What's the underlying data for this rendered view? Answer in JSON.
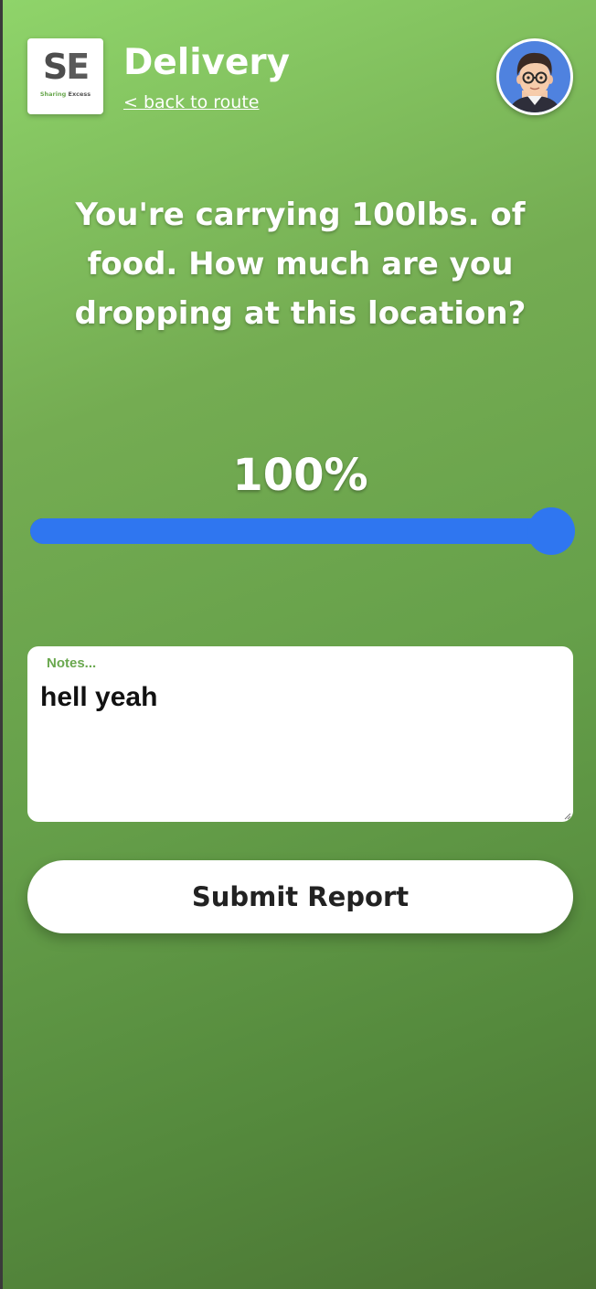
{
  "header": {
    "logo": {
      "letters": [
        "S",
        "E"
      ],
      "tagline": [
        "Sharing",
        "Excess"
      ]
    },
    "title": "Delivery",
    "back_link": "< back to route"
  },
  "question": {
    "lines": [
      "You're carrying 100lbs. of",
      "food. How much are you",
      "dropping at this location?"
    ]
  },
  "slider": {
    "value_label": "100%",
    "value": 100,
    "min": 0,
    "max": 100,
    "color": "#2f76f0"
  },
  "notes": {
    "label": "Notes...",
    "value": "hell yeah"
  },
  "submit_label": "Submit Report",
  "colors": {
    "accent_green": "#6aa84f",
    "slider_blue": "#2f76f0"
  }
}
